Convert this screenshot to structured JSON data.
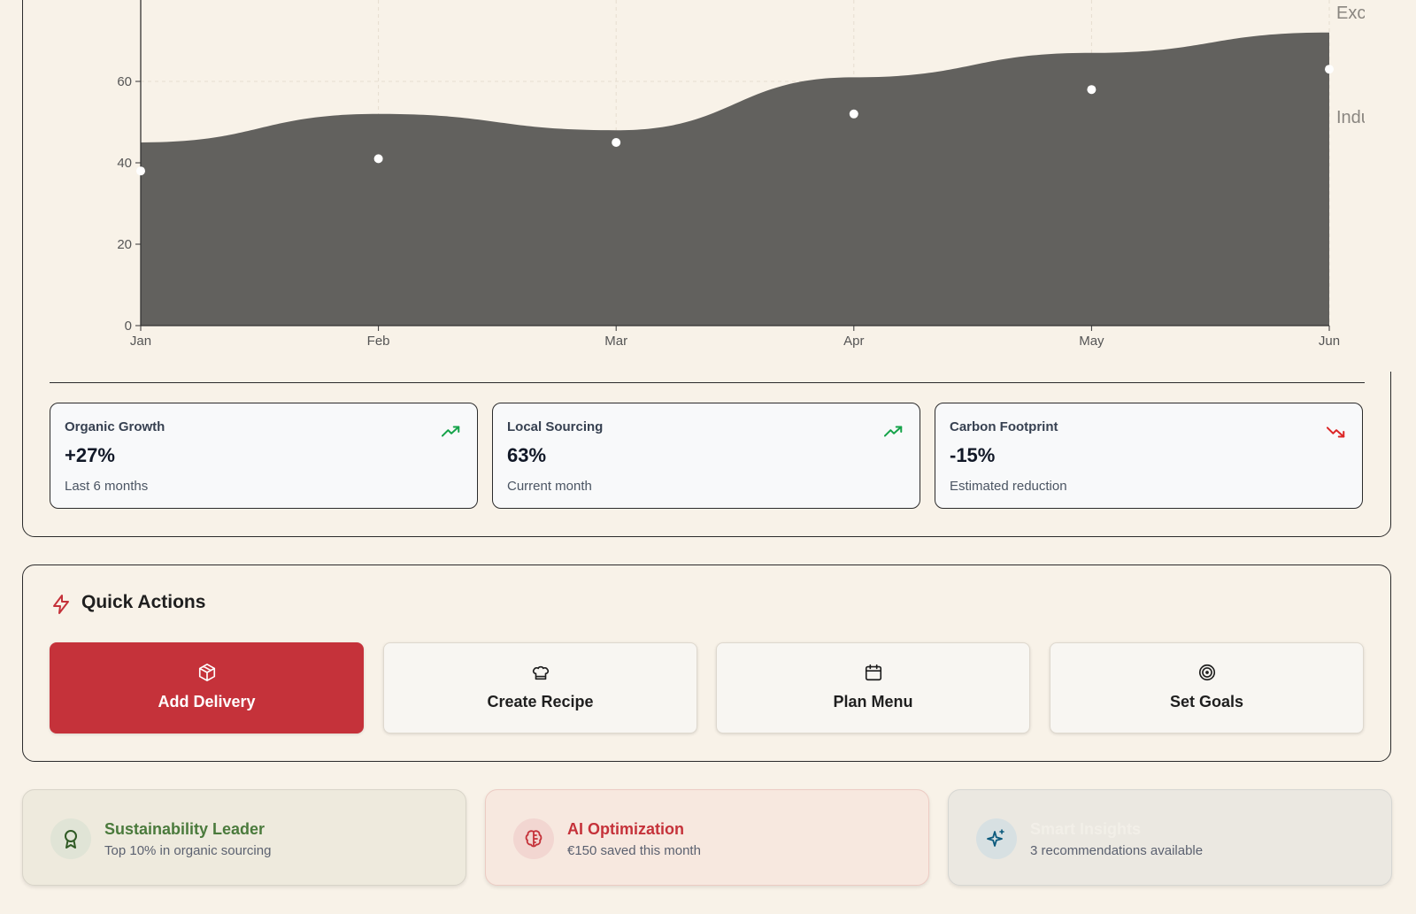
{
  "chart_data": {
    "type": "area",
    "x": [
      "Jan",
      "Feb",
      "Mar",
      "Apr",
      "May",
      "Jun"
    ],
    "ylim": [
      0,
      80
    ],
    "yticks": [
      0,
      20,
      40,
      60
    ],
    "series": [
      {
        "values": [
          45,
          52,
          48,
          61,
          67,
          72
        ]
      },
      {
        "values": [
          38,
          41,
          45,
          52,
          58,
          63
        ]
      }
    ],
    "legend_partial": [
      "Exc",
      "Indu"
    ],
    "grid": true,
    "area_color": "#62615e",
    "point_color": "#ffffff"
  },
  "stats": [
    {
      "label": "Organic Growth",
      "value": "+27%",
      "sub": "Last 6 months",
      "trend": "up",
      "icon": "trending-up-icon"
    },
    {
      "label": "Local Sourcing",
      "value": "63%",
      "sub": "Current month",
      "trend": "up",
      "icon": "trending-up-icon"
    },
    {
      "label": "Carbon Footprint",
      "value": "-15%",
      "sub": "Estimated reduction",
      "trend": "down",
      "icon": "trending-down-icon"
    }
  ],
  "quick_actions": {
    "title": "Quick Actions",
    "icon": "lightning-icon",
    "buttons": [
      {
        "label": "Add Delivery",
        "icon": "package-icon"
      },
      {
        "label": "Create Recipe",
        "icon": "chef-hat-icon"
      },
      {
        "label": "Plan Menu",
        "icon": "calendar-icon"
      },
      {
        "label": "Set Goals",
        "icon": "target-icon"
      }
    ]
  },
  "badges": [
    {
      "title": "Sustainability Leader",
      "sub": "Top 10% in organic sourcing",
      "icon": "award-icon"
    },
    {
      "title": "AI Optimization",
      "sub": "€150 saved this month",
      "icon": "brain-icon"
    },
    {
      "title": "Smart Insights",
      "sub": "3 recommendations available",
      "icon": "sparkles-icon"
    }
  ],
  "colors": {
    "background": "#f8f2e8",
    "primary": "#c5323a",
    "trend_up": "#16a34a",
    "trend_down": "#dc2626",
    "green_text": "#4a7a3c",
    "red_text": "#c5323a",
    "blue_icon": "#0b5a7d"
  }
}
